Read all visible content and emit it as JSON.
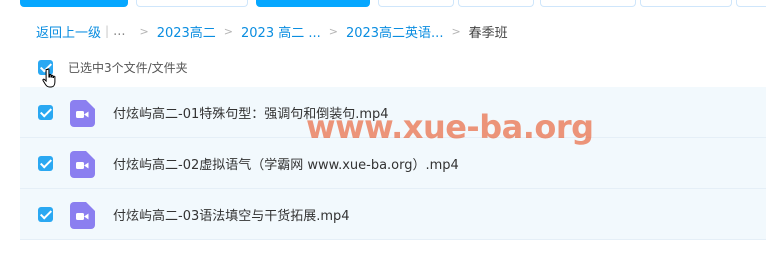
{
  "breadcrumb": {
    "back": "返回上一级",
    "sep_bar": "|",
    "dots": "...",
    "arrow": ">",
    "crumbs": [
      "2023高二",
      "2023 高二 ...",
      "2023高二英语..."
    ],
    "current": "春季班"
  },
  "selection": {
    "label": "已选中3个文件/文件夹",
    "checked": true
  },
  "files": [
    {
      "name": "付炫屿高二-01特殊句型：强调句和倒装句.mp4",
      "checked": true,
      "icon": "video-file-icon"
    },
    {
      "name": "付炫屿高二-02虚拟语气（学霸网 www.xue-ba.org）.mp4",
      "checked": true,
      "icon": "video-file-icon"
    },
    {
      "name": "付炫屿高二-03语法填空与干货拓展.mp4",
      "checked": true,
      "icon": "video-file-icon"
    }
  ],
  "watermark": "www.xue-ba.org",
  "colors": {
    "accent": "#06a7ff",
    "link": "#0a8de0",
    "checkbox": "#2aa8f2",
    "row_bg": "#f2f9fd",
    "file_icon": "#8b7ff0",
    "watermark": "#e85628"
  }
}
